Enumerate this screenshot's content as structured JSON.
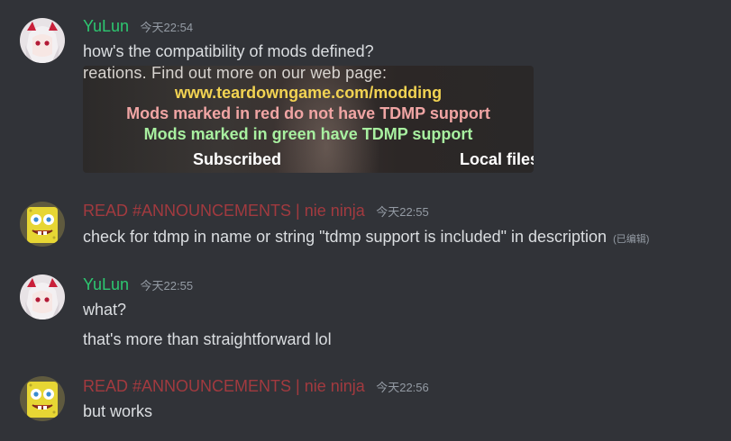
{
  "messages": [
    {
      "username": "YuLun",
      "timestamp": "今天22:54",
      "lines": [
        "how's the compatibility of mods defined?"
      ],
      "attachment": {
        "line_top": "reations. Find out more on our web page:",
        "url": "www.teardowngame.com/modding",
        "red_note": "Mods marked in red do not have TDMP support",
        "green_note": "Mods marked in green have TDMP support",
        "subscribed": "Subscribed",
        "local_files": "Local files"
      }
    },
    {
      "username": "READ #ANNOUNCEMENTS | nie ninja",
      "timestamp": "今天22:55",
      "lines": [
        "check for tdmp in name or string \"tdmp support is included\" in description"
      ],
      "edited": "(已编辑)"
    },
    {
      "username": "YuLun",
      "timestamp": "今天22:55",
      "lines": [
        "what?",
        "that's more than straightforward lol"
      ]
    },
    {
      "username": "READ #ANNOUNCEMENTS | nie ninja",
      "timestamp": "今天22:56",
      "lines": [
        "but works"
      ]
    }
  ],
  "colors": {
    "background": "#313338",
    "username_green": "#2dc770",
    "username_red": "#a23a3f",
    "text": "#dbdee1",
    "timestamp": "#949ba4"
  }
}
